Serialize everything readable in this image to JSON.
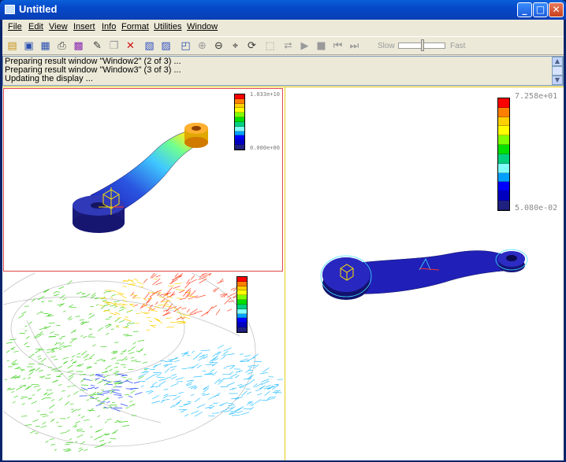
{
  "window": {
    "title": "Untitled",
    "icon": "app-icon"
  },
  "title_buttons": {
    "minimize": "_",
    "maximize": "□",
    "close": "✕"
  },
  "menu": [
    {
      "label": "File"
    },
    {
      "label": "Edit"
    },
    {
      "label": "View"
    },
    {
      "label": "Insert"
    },
    {
      "label": "Info"
    },
    {
      "label": "Format"
    },
    {
      "label": "Utilities"
    },
    {
      "label": "Window"
    }
  ],
  "toolbar": {
    "slow_label": "Slow",
    "fast_label": "Fast",
    "speed": 0.5,
    "icons": [
      "open-icon",
      "save-icon",
      "save-as-icon",
      "print-icon",
      "color-icon",
      "edit-icon",
      "copy-icon",
      "delete-icon",
      "result-icon",
      "result-edit-icon",
      "fit-icon",
      "zoom-in-icon",
      "zoom-out-icon",
      "zoom-box-icon",
      "spin-icon",
      "select-icon",
      "animate-path-icon",
      "play-icon",
      "stop-icon",
      "step-back-icon",
      "step-forward-icon"
    ]
  },
  "messages": [
    "Preparing result window \"Window2\" (2 of 3) ...",
    "Preparing result window \"Window3\" (3 of 3) ...",
    "Updating the display ..."
  ],
  "viewports": {
    "window1": {
      "legend_max": "1.033e+10",
      "legend_min": "0.000e+00"
    },
    "window2": {
      "legend_max": "7.258e+01",
      "legend_min": "5.080e-02"
    },
    "window3": {}
  },
  "legend_colors": [
    "#ff0000",
    "#ff8000",
    "#ffd000",
    "#ffff00",
    "#80ff00",
    "#00e000",
    "#00d080",
    "#80ffff",
    "#00a0ff",
    "#0000ff",
    "#0000c0",
    "#202080"
  ]
}
